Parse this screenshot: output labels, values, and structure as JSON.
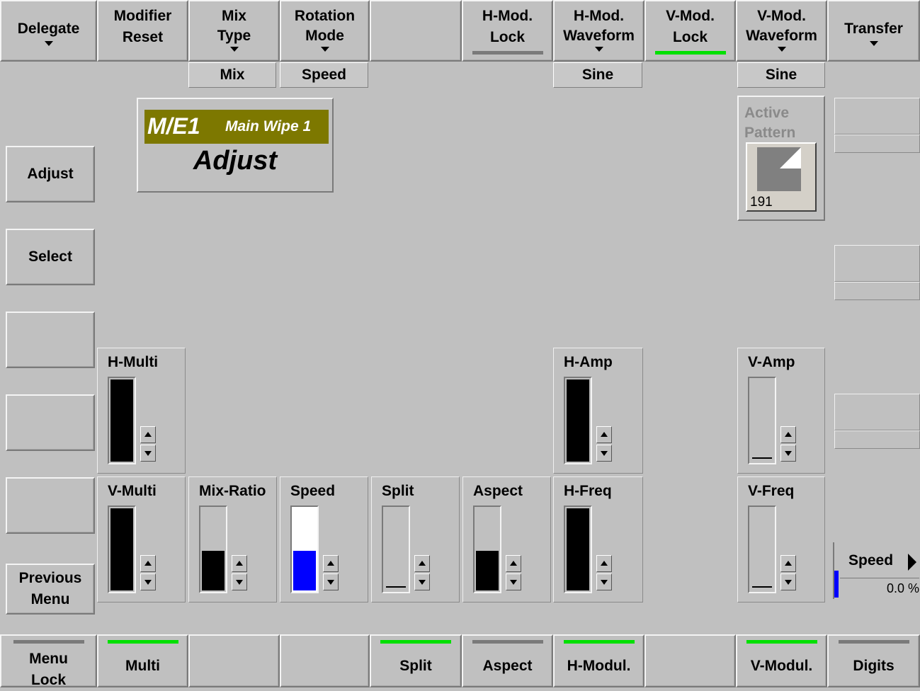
{
  "top_bar": {
    "delegate": "Delegate",
    "modifier_reset_1": "Modifier",
    "modifier_reset_2": "Reset",
    "mix_type_1": "Mix",
    "mix_type_2": "Type",
    "rotation_mode_1": "Rotation",
    "rotation_mode_2": "Mode",
    "h_mod_lock_1": "H-Mod.",
    "h_mod_lock_2": "Lock",
    "h_mod_waveform_1": "H-Mod.",
    "h_mod_waveform_2": "Waveform",
    "v_mod_lock_1": "V-Mod.",
    "v_mod_lock_2": "Lock",
    "v_mod_waveform_1": "V-Mod.",
    "v_mod_waveform_2": "Waveform",
    "transfer": "Transfer"
  },
  "values": {
    "mix_type": "Mix",
    "rotation_mode": "Speed",
    "h_mod_waveform": "Sine",
    "v_mod_waveform": "Sine"
  },
  "title": {
    "me": "M/E1",
    "wipe": "Main Wipe 1",
    "mode": "Adjust"
  },
  "left_menu": {
    "adjust": "Adjust",
    "select": "Select",
    "previous_1": "Previous",
    "previous_2": "Menu"
  },
  "active_pattern": {
    "label_1": "Active",
    "label_2": "Pattern",
    "number": "191"
  },
  "controls": {
    "h_multi": "H-Multi",
    "h_amp": "H-Amp",
    "v_amp": "V-Amp",
    "v_multi": "V-Multi",
    "mix_ratio": "Mix-Ratio",
    "speed": "Speed",
    "split": "Split",
    "aspect": "Aspect",
    "h_freq": "H-Freq",
    "v_freq": "V-Freq"
  },
  "speed_readout": {
    "label": "Speed",
    "value": "0.0 %"
  },
  "bottom_bar": {
    "menu_lock_1": "Menu",
    "menu_lock_2": "Lock",
    "multi": "Multi",
    "split": "Split",
    "aspect": "Aspect",
    "h_modul": "H-Modul.",
    "v_modul": "V-Modul.",
    "digits": "Digits"
  },
  "levels": {
    "h_multi": 1.0,
    "h_amp": 1.0,
    "v_amp": 0.0,
    "v_multi": 1.0,
    "mix_ratio": 0.5,
    "speed": 0.5,
    "split": 0.0,
    "aspect": 0.5,
    "h_freq": 1.0,
    "v_freq": 0.0
  },
  "colors": {
    "indicator_on": "#00e000",
    "indicator_off": "#7a7a7a",
    "title_bg": "#7d7800",
    "speed_fill": "#0000ff"
  }
}
